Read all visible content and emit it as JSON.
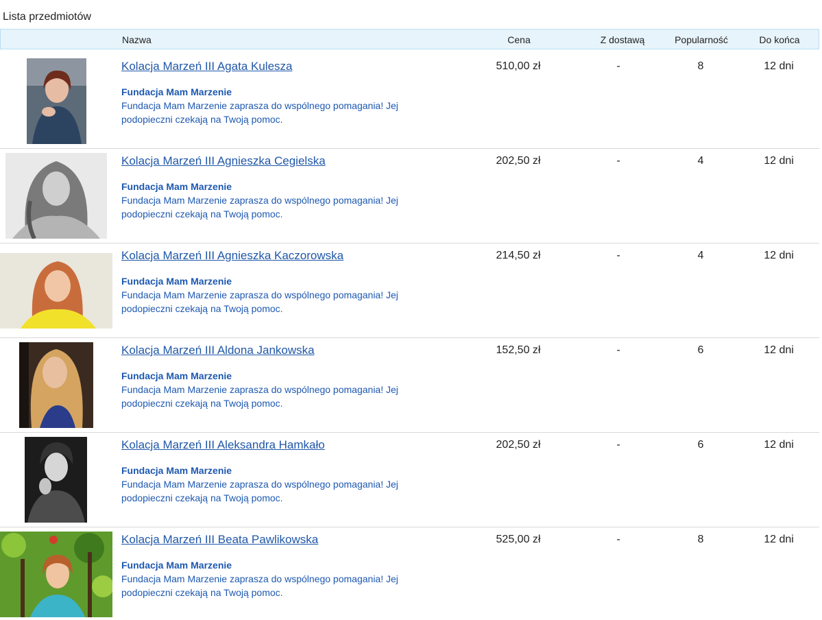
{
  "list_title": "Lista przedmiotów",
  "headers": {
    "name": "Nazwa",
    "price": "Cena",
    "delivery": "Z dostawą",
    "popularity": "Popularność",
    "ends": "Do końca"
  },
  "items": [
    {
      "title": "Kolacja Marzeń III Agata Kulesza",
      "seller": "Fundacja Mam Marzenie",
      "desc_line1": "Fundacja Mam Marzenie zaprasza do wspólnego pomagania! Jej",
      "desc_line2": "podopieczni czekają na Twoją pomoc.",
      "price": "510,00 zł",
      "delivery": "-",
      "popularity": "8",
      "ends": "12 dni"
    },
    {
      "title": "Kolacja Marzeń III Agnieszka Cegielska",
      "seller": "Fundacja Mam Marzenie",
      "desc_line1": "Fundacja Mam Marzenie zaprasza do wspólnego pomagania! Jej",
      "desc_line2": "podopieczni czekają na Twoją pomoc.",
      "price": "202,50 zł",
      "delivery": "-",
      "popularity": "4",
      "ends": "12 dni"
    },
    {
      "title": "Kolacja Marzeń III Agnieszka Kaczorowska",
      "seller": "Fundacja Mam Marzenie",
      "desc_line1": "Fundacja Mam Marzenie zaprasza do wspólnego pomagania! Jej",
      "desc_line2": "podopieczni czekają na Twoją pomoc.",
      "price": "214,50 zł",
      "delivery": "-",
      "popularity": "4",
      "ends": "12 dni"
    },
    {
      "title": "Kolacja Marzeń III Aldona Jankowska",
      "seller": "Fundacja Mam Marzenie",
      "desc_line1": "Fundacja Mam Marzenie zaprasza do wspólnego pomagania! Jej",
      "desc_line2": "podopieczni czekają na Twoją pomoc.",
      "price": "152,50 zł",
      "delivery": "-",
      "popularity": "6",
      "ends": "12 dni"
    },
    {
      "title": "Kolacja Marzeń III Aleksandra Hamkało",
      "seller": "Fundacja Mam Marzenie",
      "desc_line1": "Fundacja Mam Marzenie zaprasza do wspólnego pomagania! Jej",
      "desc_line2": "podopieczni czekają na Twoją pomoc.",
      "price": "202,50 zł",
      "delivery": "-",
      "popularity": "6",
      "ends": "12 dni"
    },
    {
      "title": "Kolacja Marzeń III Beata Pawlikowska",
      "seller": "Fundacja Mam Marzenie",
      "desc_line1": "Fundacja Mam Marzenie zaprasza do wspólnego pomagania! Jej",
      "desc_line2": "podopieczni czekają na Twoją pomoc.",
      "price": "525,00 zł",
      "delivery": "-",
      "popularity": "8",
      "ends": "12 dni"
    }
  ],
  "colors": {
    "link": "#1f57a8",
    "header_bg": "#e8f4fb",
    "header_border": "#b9def2"
  }
}
